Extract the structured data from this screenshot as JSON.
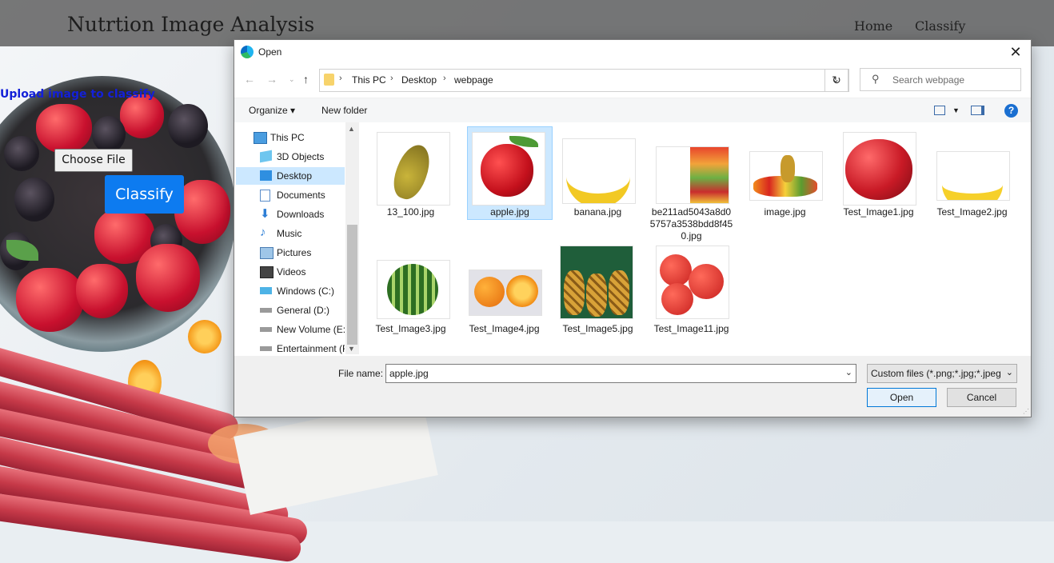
{
  "page": {
    "brand": "Nutrtion Image Analysis",
    "nav": [
      "Home",
      "Classify"
    ],
    "upload_label": "Upload image to classify",
    "choose_file": "Choose File",
    "classify_button": "Classify"
  },
  "dialog": {
    "title": "Open",
    "breadcrumb": [
      "This PC",
      "Desktop",
      "webpage"
    ],
    "search_placeholder": "Search webpage",
    "toolbar": {
      "organize": "Organize ▾",
      "new_folder": "New folder",
      "help": "?"
    },
    "sidebar": [
      {
        "label": "This PC",
        "icon": "computer-icon"
      },
      {
        "label": "3D Objects",
        "icon": "cube-icon"
      },
      {
        "label": "Desktop",
        "icon": "desktop-icon",
        "selected": true
      },
      {
        "label": "Documents",
        "icon": "document-icon"
      },
      {
        "label": "Downloads",
        "icon": "download-icon"
      },
      {
        "label": "Music",
        "icon": "music-icon"
      },
      {
        "label": "Pictures",
        "icon": "pictures-icon"
      },
      {
        "label": "Videos",
        "icon": "video-icon"
      },
      {
        "label": "Windows (C:)",
        "icon": "windows-drive-icon"
      },
      {
        "label": "General (D:)",
        "icon": "drive-icon"
      },
      {
        "label": "New Volume (E:)",
        "icon": "drive-icon"
      },
      {
        "label": "Entertainment (F",
        "icon": "drive-icon"
      }
    ],
    "files": [
      {
        "name": "13_100.jpg",
        "thumb": "pear"
      },
      {
        "name": "apple.jpg",
        "thumb": "apple",
        "selected": true
      },
      {
        "name": "banana.jpg",
        "thumb": "banana"
      },
      {
        "name": "be211ad5043a8d05757a3538bdd8f450.jpg",
        "thumb": "mixed"
      },
      {
        "name": "image.jpg",
        "thumb": "fruitbowl"
      },
      {
        "name": "Test_Image1.jpg",
        "thumb": "apple-large"
      },
      {
        "name": "Test_Image2.jpg",
        "thumb": "bananas"
      },
      {
        "name": "Test_Image3.jpg",
        "thumb": "watermelon"
      },
      {
        "name": "Test_Image4.jpg",
        "thumb": "orange"
      },
      {
        "name": "Test_Image5.jpg",
        "thumb": "pineapple"
      },
      {
        "name": "Test_Image11.jpg",
        "thumb": "apples"
      }
    ],
    "file_name_label": "File name:",
    "file_name_value": "apple.jpg",
    "filter": "Custom files (*.png;*.jpg;*.jpeg",
    "open": "Open",
    "cancel": "Cancel"
  }
}
